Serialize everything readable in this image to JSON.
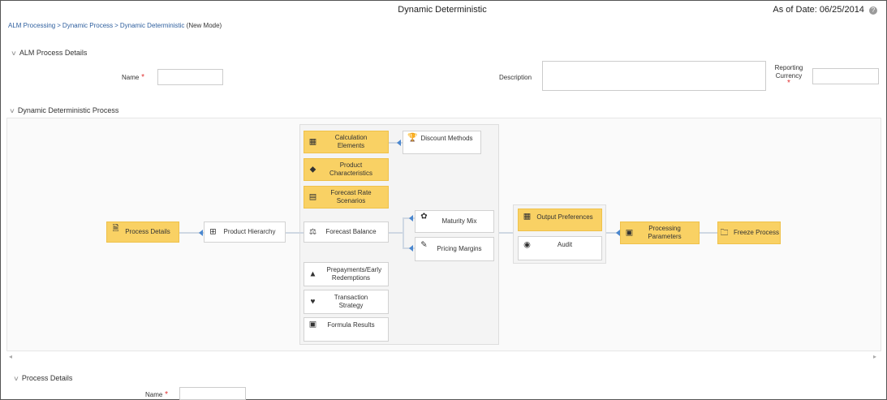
{
  "header": {
    "title": "Dynamic Deterministic",
    "as_of_label": "As of Date:",
    "as_of_value": "06/25/2014",
    "help_icon": "question-circle-icon"
  },
  "breadcrumb": {
    "items": [
      "ALM Processing",
      "Dynamic Process",
      "Dynamic Deterministic"
    ],
    "separator": ">",
    "mode": "(New Mode)"
  },
  "alm_details": {
    "header": "ALM Process Details",
    "name_label": "Name",
    "name_value": "",
    "description_label": "Description",
    "description_value": "",
    "currency_label_1": "Reporting",
    "currency_label_2": "Currency",
    "currency_value": ""
  },
  "diagram": {
    "header": "Dynamic Deterministic Process",
    "nodes": {
      "process_details": "Process Details",
      "product_hierarchy": "Product Hierarchy",
      "calc_elements": "Calculation Elements",
      "discount_methods": "Discount Methods",
      "product_characteristics": "Product Characteristics",
      "forecast_rate_scenarios": "Forecast Rate Scenarios",
      "forecast_balance": "Forecast Balance",
      "maturity_mix": "Maturity Mix",
      "pricing_margins": "Pricing Margins",
      "prepayments": "Prepayments/Early Redemptions",
      "transaction_strategy": "Transaction Strategy",
      "formula_results": "Formula Results",
      "output_preferences": "Output Preferences",
      "audit": "Audit",
      "processing_parameters": "Processing Parameters",
      "freeze_process": "Freeze Process"
    },
    "active_color": "#f9d164"
  },
  "process_details": {
    "header": "Process Details",
    "name_label": "Name",
    "name_value": ""
  },
  "scroll": {
    "left": "◂",
    "right": "▸"
  }
}
